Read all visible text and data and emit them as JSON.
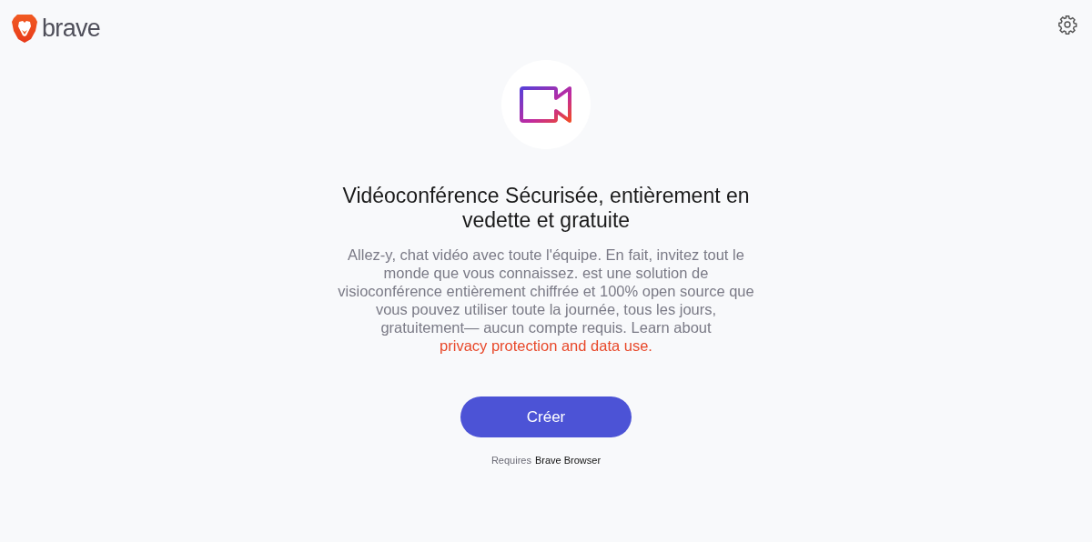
{
  "header": {
    "logo_text": "brave"
  },
  "hero": {
    "title": "Vidéoconférence Sécurisée, entièrement en vedette et gratuite",
    "description": "Allez-y, chat vidéo avec toute l'équipe. En fait, invitez tout le monde que vous connaissez. est une solution de visioconférence entièrement chiffrée et 100% open source que vous pouvez utiliser toute la journée, tous les jours, gratuitement— aucun compte requis. Learn about",
    "link": "privacy protection and data use.",
    "button": "Créer",
    "requirement": {
      "label": "Requires",
      "browser": "Brave Browser"
    }
  }
}
